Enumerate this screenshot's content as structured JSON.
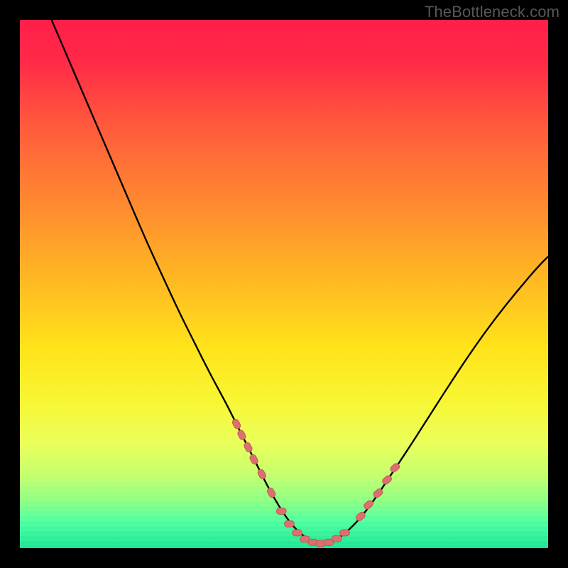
{
  "watermark": "TheBottleneck.com",
  "colors": {
    "bg_black": "#000000",
    "curve": "#000000",
    "marker_fill": "#dd6f6f",
    "marker_stroke": "#b75252",
    "gradient_stops": [
      {
        "offset": 0.0,
        "color": "#ff1e4a"
      },
      {
        "offset": 0.08,
        "color": "#ff2a47"
      },
      {
        "offset": 0.2,
        "color": "#ff5a3c"
      },
      {
        "offset": 0.35,
        "color": "#ff8a30"
      },
      {
        "offset": 0.5,
        "color": "#ffbb22"
      },
      {
        "offset": 0.62,
        "color": "#ffe31a"
      },
      {
        "offset": 0.72,
        "color": "#f8f633"
      },
      {
        "offset": 0.8,
        "color": "#eaff5a"
      },
      {
        "offset": 0.86,
        "color": "#c6ff6e"
      },
      {
        "offset": 0.91,
        "color": "#8dff81"
      },
      {
        "offset": 0.95,
        "color": "#4dffa0"
      },
      {
        "offset": 1.0,
        "color": "#19e593"
      }
    ]
  },
  "chart_data": {
    "type": "line",
    "title": "",
    "xlabel": "",
    "ylabel": "",
    "xlim": [
      0,
      100
    ],
    "ylim": [
      0,
      100
    ],
    "grid": false,
    "series": [
      {
        "name": "bottleneck-curve",
        "x": [
          6,
          9,
          12,
          15,
          18,
          21,
          24,
          27,
          30,
          33,
          36,
          39,
          41,
          43,
          45,
          47,
          49,
          51,
          53,
          55,
          57,
          59,
          61,
          64,
          67,
          70,
          74,
          78,
          82,
          86,
          90,
          94,
          98,
          100
        ],
        "values": [
          100,
          93,
          86,
          79,
          72,
          65,
          58,
          51.5,
          45,
          39,
          33,
          27.5,
          23.5,
          19.5,
          15.5,
          11.5,
          8,
          5,
          2.8,
          1.4,
          0.9,
          1.2,
          2.3,
          5.1,
          9,
          13.5,
          19.5,
          25.8,
          32,
          38,
          43.5,
          48.5,
          53.2,
          55.2
        ]
      }
    ],
    "markers": {
      "name": "highlight-points",
      "x_left": [
        41.0,
        42.0,
        43.2,
        44.3,
        45.8,
        47.6
      ],
      "y_left": [
        23.5,
        21.4,
        19.1,
        16.8,
        14.0,
        10.5
      ],
      "x_floor": [
        49.5,
        51.0,
        52.5,
        54.0,
        55.5,
        57.0,
        58.5,
        60.0,
        61.5
      ],
      "y_floor": [
        7.0,
        4.6,
        2.9,
        1.7,
        1.1,
        0.9,
        1.1,
        1.8,
        2.9
      ],
      "x_right": [
        64.5,
        66.0,
        67.8,
        69.5,
        71.0
      ],
      "y_right": [
        6.0,
        8.2,
        10.4,
        12.9,
        15.2
      ]
    }
  }
}
